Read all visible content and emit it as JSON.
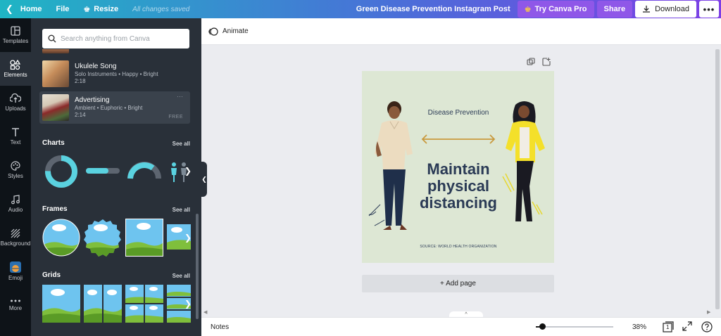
{
  "topbar": {
    "home": "Home",
    "file": "File",
    "resize": "Resize",
    "saved_status": "All changes saved",
    "title": "Green Disease Prevention Instagram Post",
    "try_pro": "Try Canva Pro",
    "share": "Share",
    "download": "Download",
    "more": "•••"
  },
  "rail": {
    "items": [
      {
        "label": "Templates",
        "icon": "templates-icon"
      },
      {
        "label": "Elements",
        "icon": "elements-icon",
        "active": true
      },
      {
        "label": "Uploads",
        "icon": "upload-icon"
      },
      {
        "label": "Text",
        "icon": "text-icon"
      },
      {
        "label": "Styles",
        "icon": "palette-icon"
      },
      {
        "label": "Audio",
        "icon": "music-icon"
      },
      {
        "label": "Background",
        "icon": "background-icon"
      },
      {
        "label": "Emoji",
        "icon": "emoji-icon"
      },
      {
        "label": "More",
        "icon": "more-icon"
      }
    ]
  },
  "panel": {
    "search_placeholder": "Search anything from Canva",
    "audio": [
      {
        "title": "Ukulele Song",
        "meta": "Solo Instruments • Happy • Bright",
        "duration": "2:18"
      },
      {
        "title": "Advertising",
        "meta": "Ambient • Euphoric • Bright",
        "duration": "2:14",
        "badge": "FREE",
        "menu": "···"
      }
    ],
    "sections": {
      "charts": "Charts",
      "frames": "Frames",
      "grids": "Grids"
    },
    "see_all": "See all"
  },
  "editor": {
    "animate": "Animate",
    "add_page": "+ Add page",
    "canvas": {
      "heading": "Disease Prevention",
      "main": "Maintain physical distancing",
      "source": "SOURCE: WORLD HEALTH ORGANIZATION"
    },
    "notes_chevron": "^"
  },
  "bottombar": {
    "notes": "Notes",
    "zoom_percent": "38%",
    "zoom_value": 0.08,
    "page_count": "1"
  },
  "colors": {
    "accent_purple": "#8f57e8",
    "rail_bg": "#0e1318",
    "panel_bg": "#293039",
    "canvas_bg": "#dde7d4",
    "chart_teal": "#5ad2e0"
  }
}
